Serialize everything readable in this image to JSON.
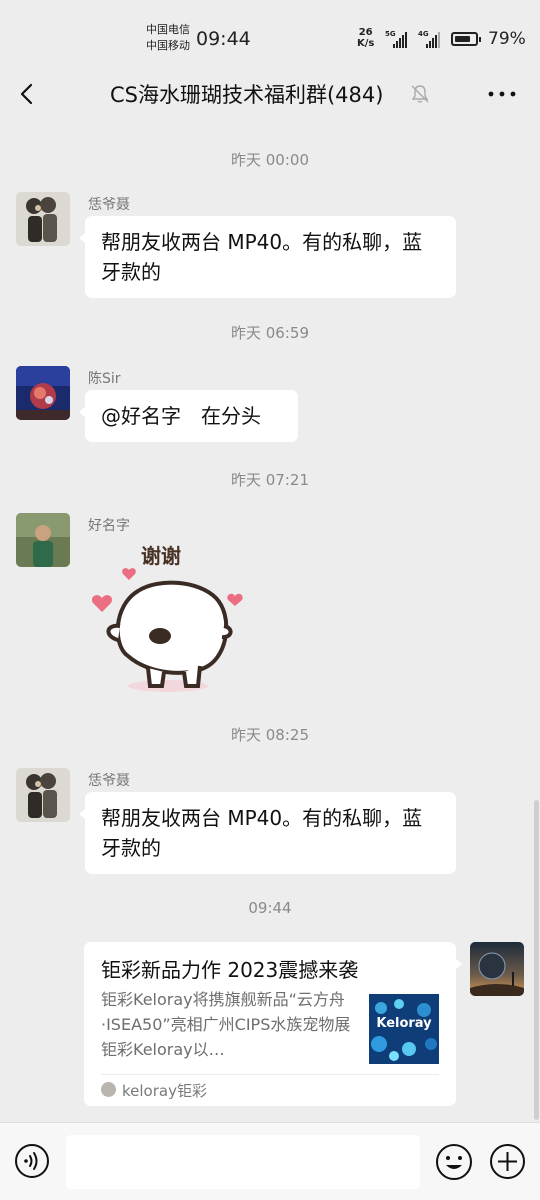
{
  "status_bar": {
    "carrier_1": "中国电信",
    "carrier_2": "中国移动",
    "time": "09:44",
    "net_speed_value": "26",
    "net_speed_unit": "K/s",
    "signal_1_label": "5G",
    "signal_2_label": "4G",
    "battery_percent": "79%",
    "battery_level": 0.79
  },
  "header": {
    "title": "CS海水珊瑚技术福利群(484)",
    "back_icon": "chevron-left-icon",
    "mute_icon": "bell-off-icon",
    "more_icon": "more-icon"
  },
  "messages": [
    {
      "type": "timestamp",
      "text": "昨天 00:00"
    },
    {
      "type": "text",
      "sender": "恁爷聂",
      "text": "帮朋友收两台 MP40。有的私聊，蓝牙款的"
    },
    {
      "type": "timestamp",
      "text": "昨天 06:59"
    },
    {
      "type": "text",
      "sender": "陈Sir",
      "text": "@好名字　在分头"
    },
    {
      "type": "timestamp",
      "text": "昨天 07:21"
    },
    {
      "type": "sticker",
      "sender": "好名字",
      "sticker_text": "谢谢"
    },
    {
      "type": "timestamp",
      "text": "昨天 08:25"
    },
    {
      "type": "text",
      "sender": "恁爷聂",
      "text": "帮朋友收两台 MP40。有的私聊，蓝牙款的"
    },
    {
      "type": "timestamp",
      "text": "09:44"
    },
    {
      "type": "link",
      "title": "钜彩新品力作 2023震撼来袭",
      "description": "钜彩Keloray将携旗舰新品“云方舟·ISEA50”亮相广州CIPS水族宠物展钜彩Keloray以…",
      "thumbnail_text": "Keloray",
      "source": "keloray钜彩"
    }
  ],
  "input_bar": {
    "voice_icon": "voice-icon",
    "text_value": "",
    "emoji_icon": "emoji-icon",
    "plus_icon": "plus-icon"
  },
  "colors": {
    "chat_background": "#ededed",
    "bubble": "#ffffff",
    "timestamp": "#8a8a8a"
  }
}
